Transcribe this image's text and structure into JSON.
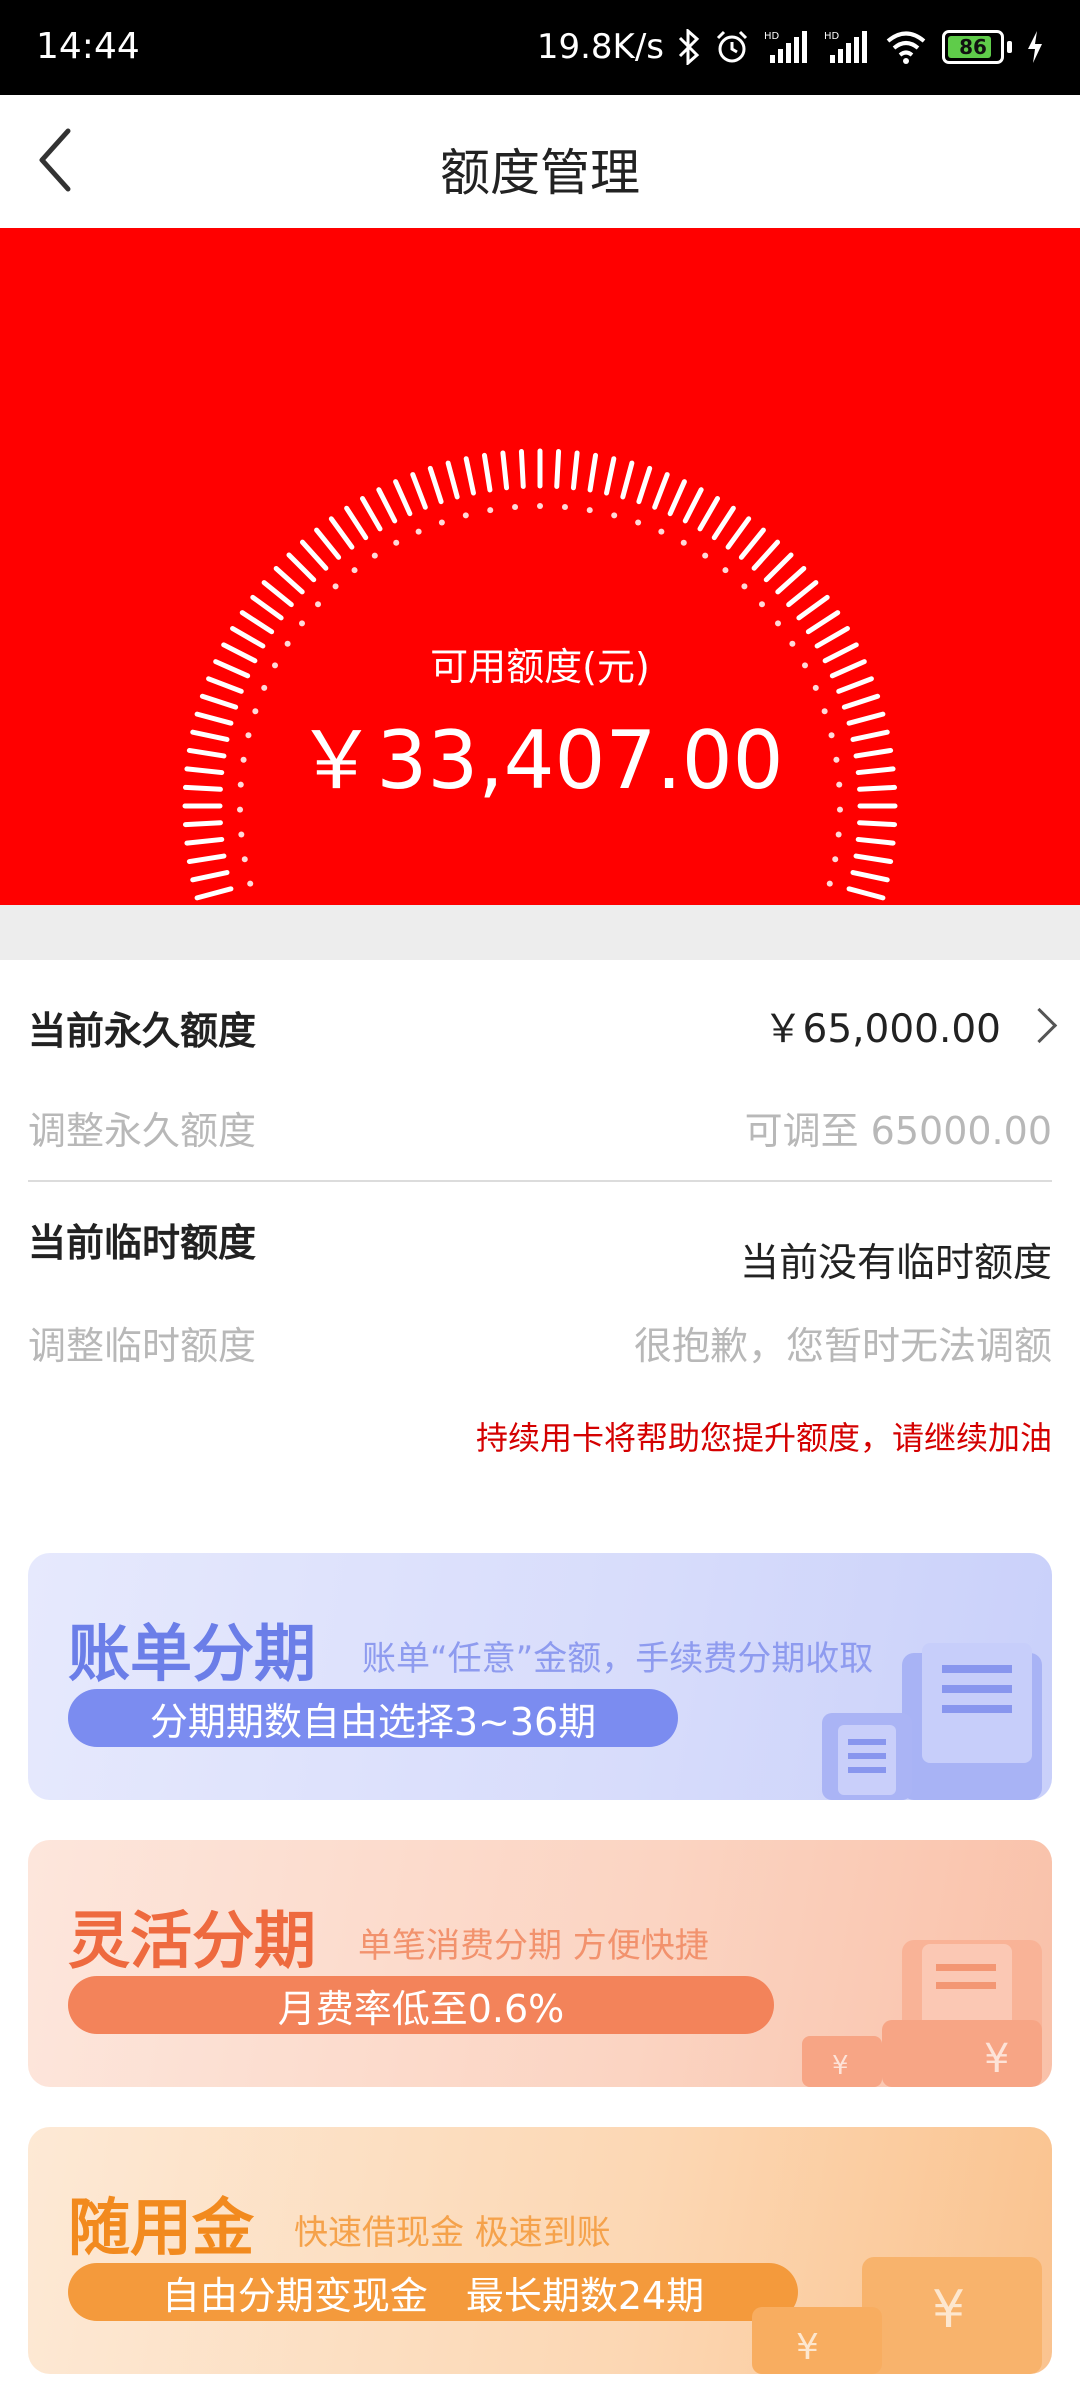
{
  "status_bar": {
    "time": "14:44",
    "net_speed": "19.8K/s",
    "battery": "86"
  },
  "nav": {
    "title": "额度管理"
  },
  "hero": {
    "label": "可用额度(元)",
    "amount": "￥33,407.00"
  },
  "permanent": {
    "label": "当前永久额度",
    "value": "￥65,000.00",
    "adjust_label": "调整永久额度",
    "adjust_value": "可调至 65000.00"
  },
  "temporary": {
    "label": "当前临时额度",
    "value": "当前没有临时额度",
    "adjust_label": "调整临时额度",
    "adjust_value": "很抱歉，您暂时无法调额"
  },
  "tip": "持续用卡将帮助您提升额度，请继续加油",
  "cards": [
    {
      "title": "账单分期",
      "subtitle": "账单“任意”金额，手续费分期收取",
      "pill": "分期期数自由选择3~36期",
      "color": "#6b7ee8"
    },
    {
      "title": "灵活分期",
      "subtitle": "单笔消费分期 方便快捷",
      "pill": "月费率低至0.6%",
      "color": "#ee6a3f"
    },
    {
      "title": "随用金",
      "subtitle": "快速借现金 极速到账",
      "pill": "自由分期变现金　最长期数24期",
      "color": "#f28a1e"
    }
  ]
}
